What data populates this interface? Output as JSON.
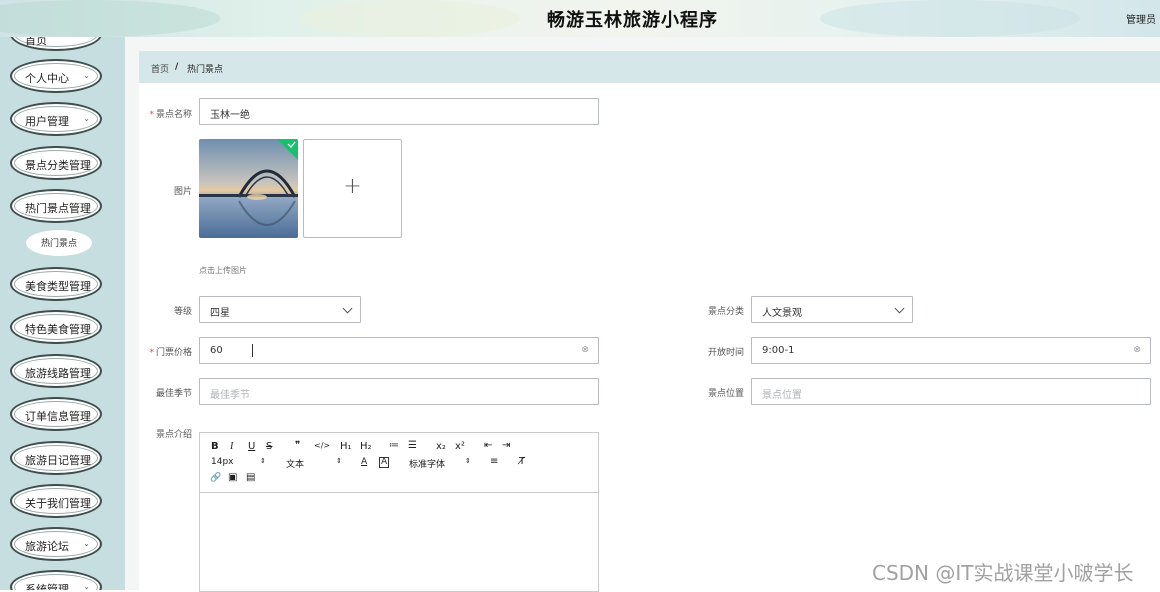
{
  "header": {
    "title": "畅游玉林旅游小程序",
    "user": "管理员"
  },
  "sidebar": {
    "top_partial_label": "首页",
    "items": [
      {
        "label": "个人中心",
        "chevron": "⌄"
      },
      {
        "label": "用户管理",
        "chevron": "⌄"
      },
      {
        "label": "景点分类管理",
        "chevron": ""
      },
      {
        "label": "热门景点管理",
        "chevron": ""
      },
      {
        "label": "美食类型管理",
        "chevron": ""
      },
      {
        "label": "特色美食管理",
        "chevron": ""
      },
      {
        "label": "旅游线路管理",
        "chevron": ""
      },
      {
        "label": "订单信息管理",
        "chevron": ""
      },
      {
        "label": "旅游日记管理",
        "chevron": ""
      },
      {
        "label": "关于我们管理",
        "chevron": ""
      },
      {
        "label": "旅游论坛",
        "chevron": "⌄"
      },
      {
        "label": "系统管理",
        "chevron": "⌄"
      }
    ],
    "sub_item": "热门景点"
  },
  "breadcrumb": {
    "home": "首页",
    "sep": "/",
    "current": "热门景点"
  },
  "form": {
    "required_mark": "*",
    "name_label": "景点名称",
    "name_value": "玉林一绝",
    "image_label": "图片",
    "upload_plus": "+",
    "upload_tip": "点击上传图片",
    "level_label": "等级",
    "level_value": "四星",
    "category_label": "景点分类",
    "category_value": "人文景观",
    "price_label": "门票价格",
    "price_value": "60",
    "hours_label": "开放时间",
    "hours_value": "9:00-1",
    "season_label": "最佳季节",
    "season_placeholder": "最佳季节",
    "location_label": "景点位置",
    "location_placeholder": "景点位置",
    "intro_label": "景点介绍",
    "clear_icon": "⊗"
  },
  "editor": {
    "row1": [
      "B",
      "I",
      "U",
      "S",
      "❞",
      "</>",
      "H₁",
      "H₂",
      "≔",
      "☰",
      "x₂",
      "x²",
      "⇤",
      "⇥"
    ],
    "font_size": "14px",
    "block_type": "文本",
    "font_family": "标准字体",
    "row2_icons": [
      "A",
      "A",
      "≡",
      "T̸"
    ],
    "row3": [
      "🔗",
      "▣",
      "▤"
    ]
  },
  "watermark": "CSDN @IT实战课堂小啵学长"
}
